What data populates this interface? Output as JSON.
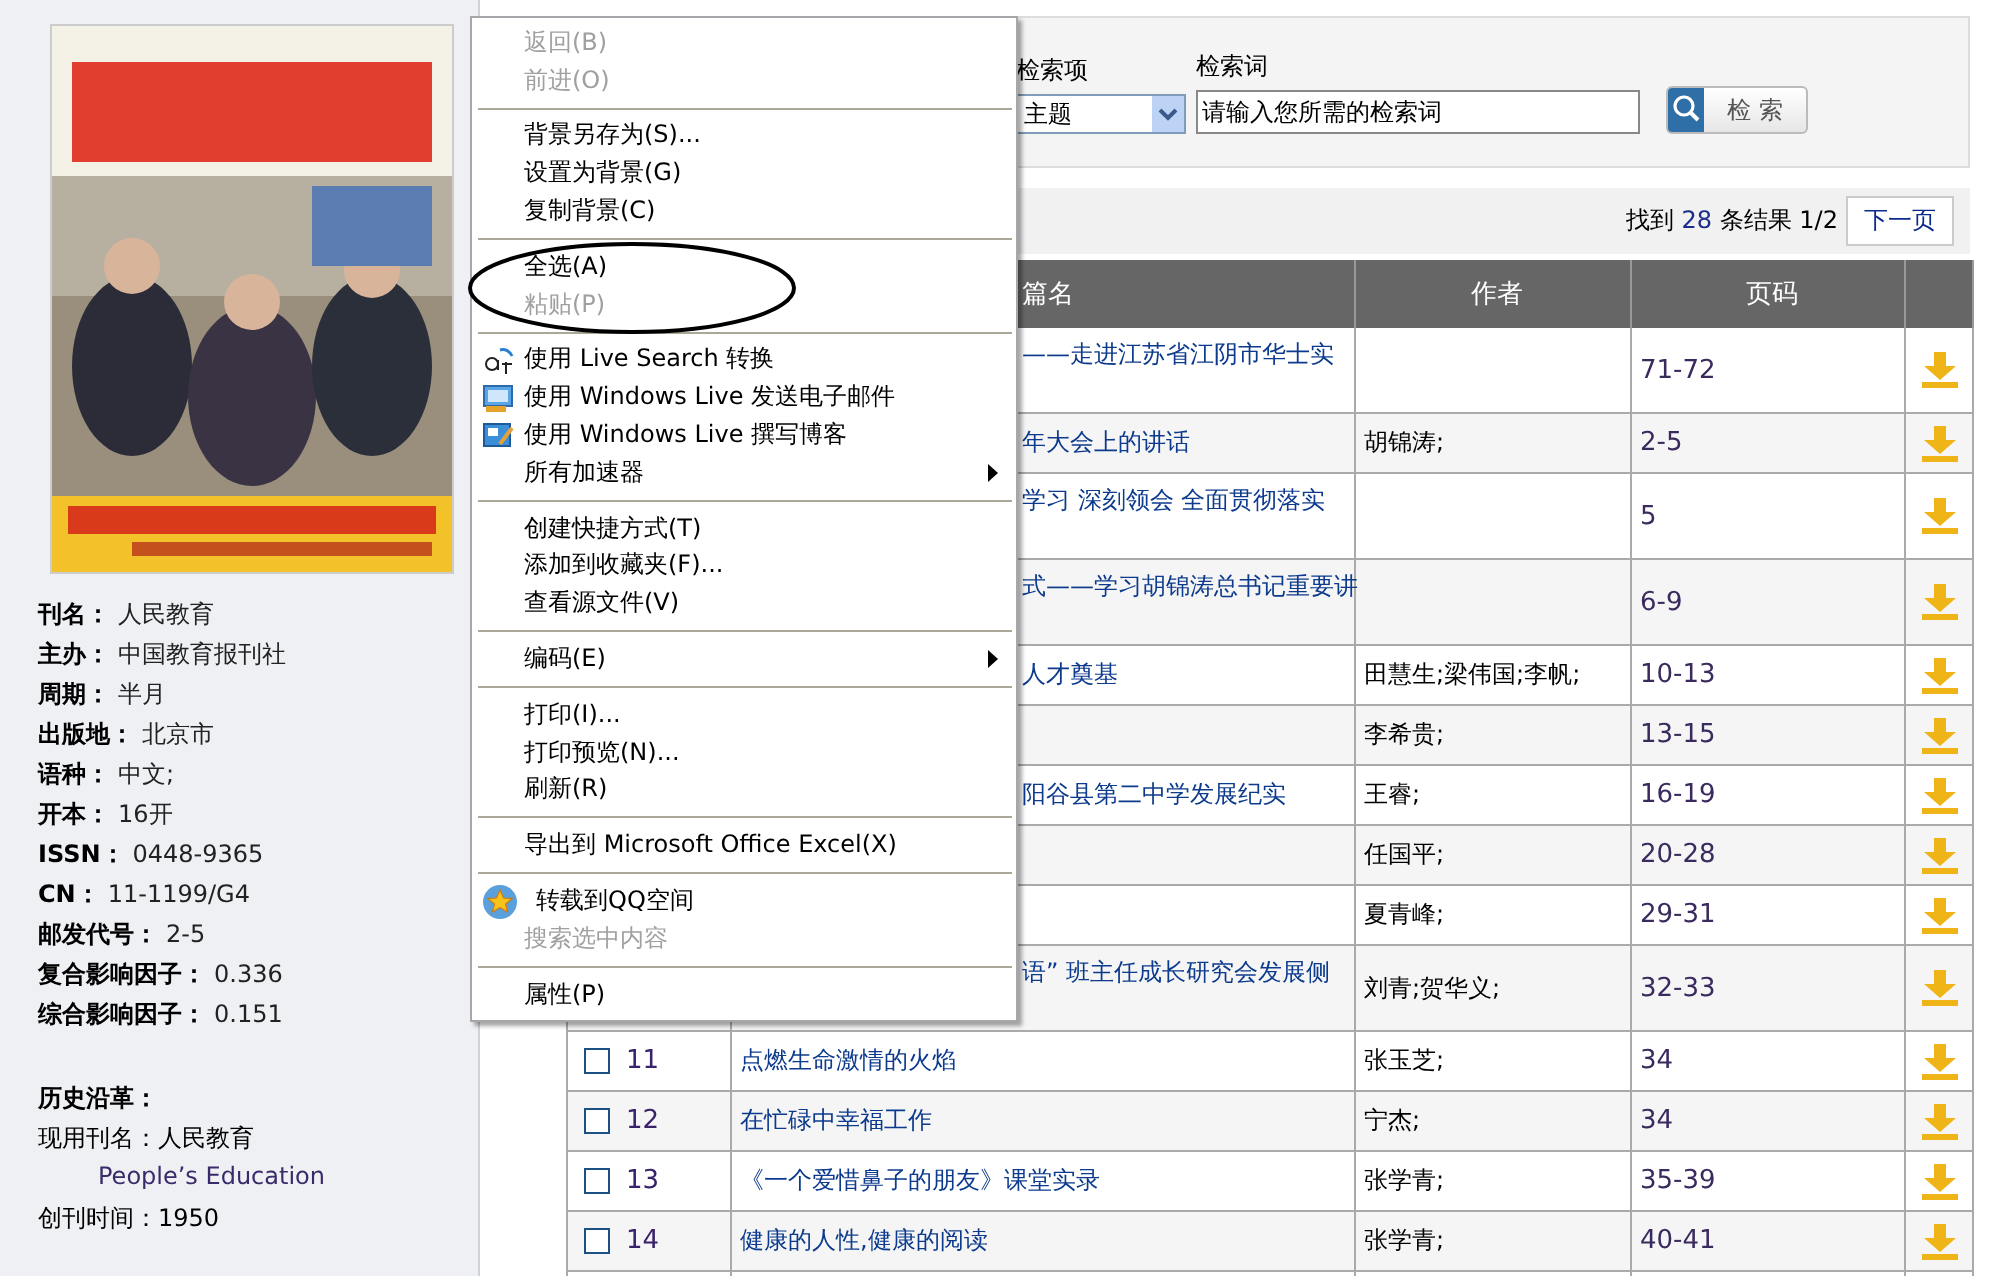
{
  "journal_info": [
    {
      "label": "刊名：",
      "value": "人民教育"
    },
    {
      "label": "主办：",
      "value": "中国教育报刊社"
    },
    {
      "label": "周期：",
      "value": "半月"
    },
    {
      "label": "出版地：",
      "value": "北京市"
    },
    {
      "label": "语种：",
      "value": "中文;"
    },
    {
      "label": "开本：",
      "value": "16开"
    },
    {
      "label": "ISSN：",
      "value": "0448-9365"
    },
    {
      "label": "CN：",
      "value": "11-1199/G4"
    },
    {
      "label": "邮发代号：",
      "value": "2-5"
    },
    {
      "label": "复合影响因子：",
      "value": "0.336"
    },
    {
      "label": "综合影响因子：",
      "value": "0.151"
    }
  ],
  "history": {
    "title": "历史沿革：",
    "current_name": "现用刊名：人民教育",
    "english_name": "People’s Education",
    "founded": "创刊时间：1950"
  },
  "search": {
    "field_label": "检索项",
    "field_value": "主题",
    "term_label": "检索词",
    "term_value": "请输入您所需的检索词",
    "button": "检 索"
  },
  "results": {
    "prefix": "找到",
    "count": "28",
    "suffix": "条结果",
    "page": "1/2",
    "next": "下一页"
  },
  "table": {
    "columns": [
      "篇名",
      "作者",
      "页码"
    ],
    "rows": [
      {
        "title": "——走进江苏省江阴市华士实",
        "author": "",
        "pages": "71-72",
        "wrapped": true
      },
      {
        "title": "年大会上的讲话",
        "author": "胡锦涛;",
        "pages": "2-5",
        "wrapped": false
      },
      {
        "title": "学习 深刻领会 全面贯彻落实",
        "author": "",
        "pages": "5",
        "wrapped": true
      },
      {
        "title": "式——学习胡锦涛总书记重要讲",
        "author": "",
        "pages": "6-9",
        "wrapped": true
      },
      {
        "title": "人才奠基",
        "author": "田慧生;梁伟国;李帆;",
        "pages": "10-13",
        "wrapped": false
      },
      {
        "title": "",
        "author": "李希贵;",
        "pages": "13-15",
        "wrapped": false
      },
      {
        "title": "阳谷县第二中学发展纪实",
        "author": "王睿;",
        "pages": "16-19",
        "wrapped": false
      },
      {
        "title": "",
        "author": "任国平;",
        "pages": "20-28",
        "wrapped": false
      },
      {
        "title": "",
        "author": "夏青峰;",
        "pages": "29-31",
        "wrapped": false
      },
      {
        "title": "语” 班主任成长研究会发展侧",
        "author": "刘青;贺华义;",
        "pages": "32-33",
        "wrapped": true
      },
      {
        "number": "11",
        "checked": false,
        "title": "点燃生命激情的火焰",
        "author": "张玉芝;",
        "pages": "34",
        "wrapped": false
      },
      {
        "number": "12",
        "checked": false,
        "title": "在忙碌中幸福工作",
        "author": "宁杰;",
        "pages": "34",
        "wrapped": false
      },
      {
        "number": "13",
        "checked": false,
        "title": "《一个爱惜鼻子的朋友》课堂实录",
        "author": "张学青;",
        "pages": "35-39",
        "wrapped": false
      },
      {
        "number": "14",
        "checked": false,
        "title": "健康的人性,健康的阅读",
        "author": "张学青;",
        "pages": "40-41",
        "wrapped": false
      }
    ]
  },
  "context_menu": [
    {
      "kind": "item",
      "label": "返回(B)",
      "disabled": true,
      "submenu": false,
      "icon": false
    },
    {
      "kind": "item",
      "label": "前进(O)",
      "disabled": true,
      "submenu": false,
      "icon": false
    },
    {
      "kind": "separator"
    },
    {
      "kind": "item",
      "label": "背景另存为(S)...",
      "disabled": false,
      "submenu": false,
      "icon": false
    },
    {
      "kind": "item",
      "label": "设置为背景(G)",
      "disabled": false,
      "submenu": false,
      "icon": false
    },
    {
      "kind": "item",
      "label": "复制背景(C)",
      "disabled": false,
      "submenu": false,
      "icon": false
    },
    {
      "kind": "separator"
    },
    {
      "kind": "item",
      "label": "全选(A)",
      "disabled": false,
      "submenu": false,
      "icon": false
    },
    {
      "kind": "item",
      "label": "粘贴(P)",
      "disabled": true,
      "submenu": false,
      "icon": false
    },
    {
      "kind": "separator"
    },
    {
      "kind": "item",
      "label": "使用 Live Search 转换",
      "disabled": false,
      "submenu": false,
      "icon": true
    },
    {
      "kind": "item",
      "label": "使用 Windows Live 发送电子邮件",
      "disabled": false,
      "submenu": false,
      "icon": true
    },
    {
      "kind": "item",
      "label": "使用 Windows Live 撰写博客",
      "disabled": false,
      "submenu": false,
      "icon": true
    },
    {
      "kind": "item",
      "label": "所有加速器",
      "disabled": false,
      "submenu": true,
      "icon": false
    },
    {
      "kind": "separator"
    },
    {
      "kind": "item",
      "label": "创建快捷方式(T)",
      "disabled": false,
      "submenu": false,
      "icon": false
    },
    {
      "kind": "item",
      "label": "添加到收藏夹(F)...",
      "disabled": false,
      "submenu": false,
      "icon": false
    },
    {
      "kind": "item",
      "label": "查看源文件(V)",
      "disabled": false,
      "submenu": false,
      "icon": false
    },
    {
      "kind": "separator"
    },
    {
      "kind": "item",
      "label": "编码(E)",
      "disabled": false,
      "submenu": true,
      "icon": false
    },
    {
      "kind": "separator"
    },
    {
      "kind": "item",
      "label": "打印(I)...",
      "disabled": false,
      "submenu": false,
      "icon": false
    },
    {
      "kind": "item",
      "label": "打印预览(N)...",
      "disabled": false,
      "submenu": false,
      "icon": false
    },
    {
      "kind": "item",
      "label": "刷新(R)",
      "disabled": false,
      "submenu": false,
      "icon": false
    },
    {
      "kind": "separator"
    },
    {
      "kind": "item",
      "label": "导出到 Microsoft Office Excel(X)",
      "disabled": false,
      "submenu": false,
      "icon": false
    },
    {
      "kind": "separator"
    },
    {
      "kind": "item",
      "label": "转载到QQ空间",
      "disabled": false,
      "submenu": false,
      "icon": true
    },
    {
      "kind": "item",
      "label": "搜索选中内容",
      "disabled": true,
      "submenu": false,
      "icon": false
    },
    {
      "kind": "separator"
    },
    {
      "kind": "item",
      "label": "属性(P)",
      "disabled": false,
      "submenu": false,
      "icon": false
    }
  ]
}
